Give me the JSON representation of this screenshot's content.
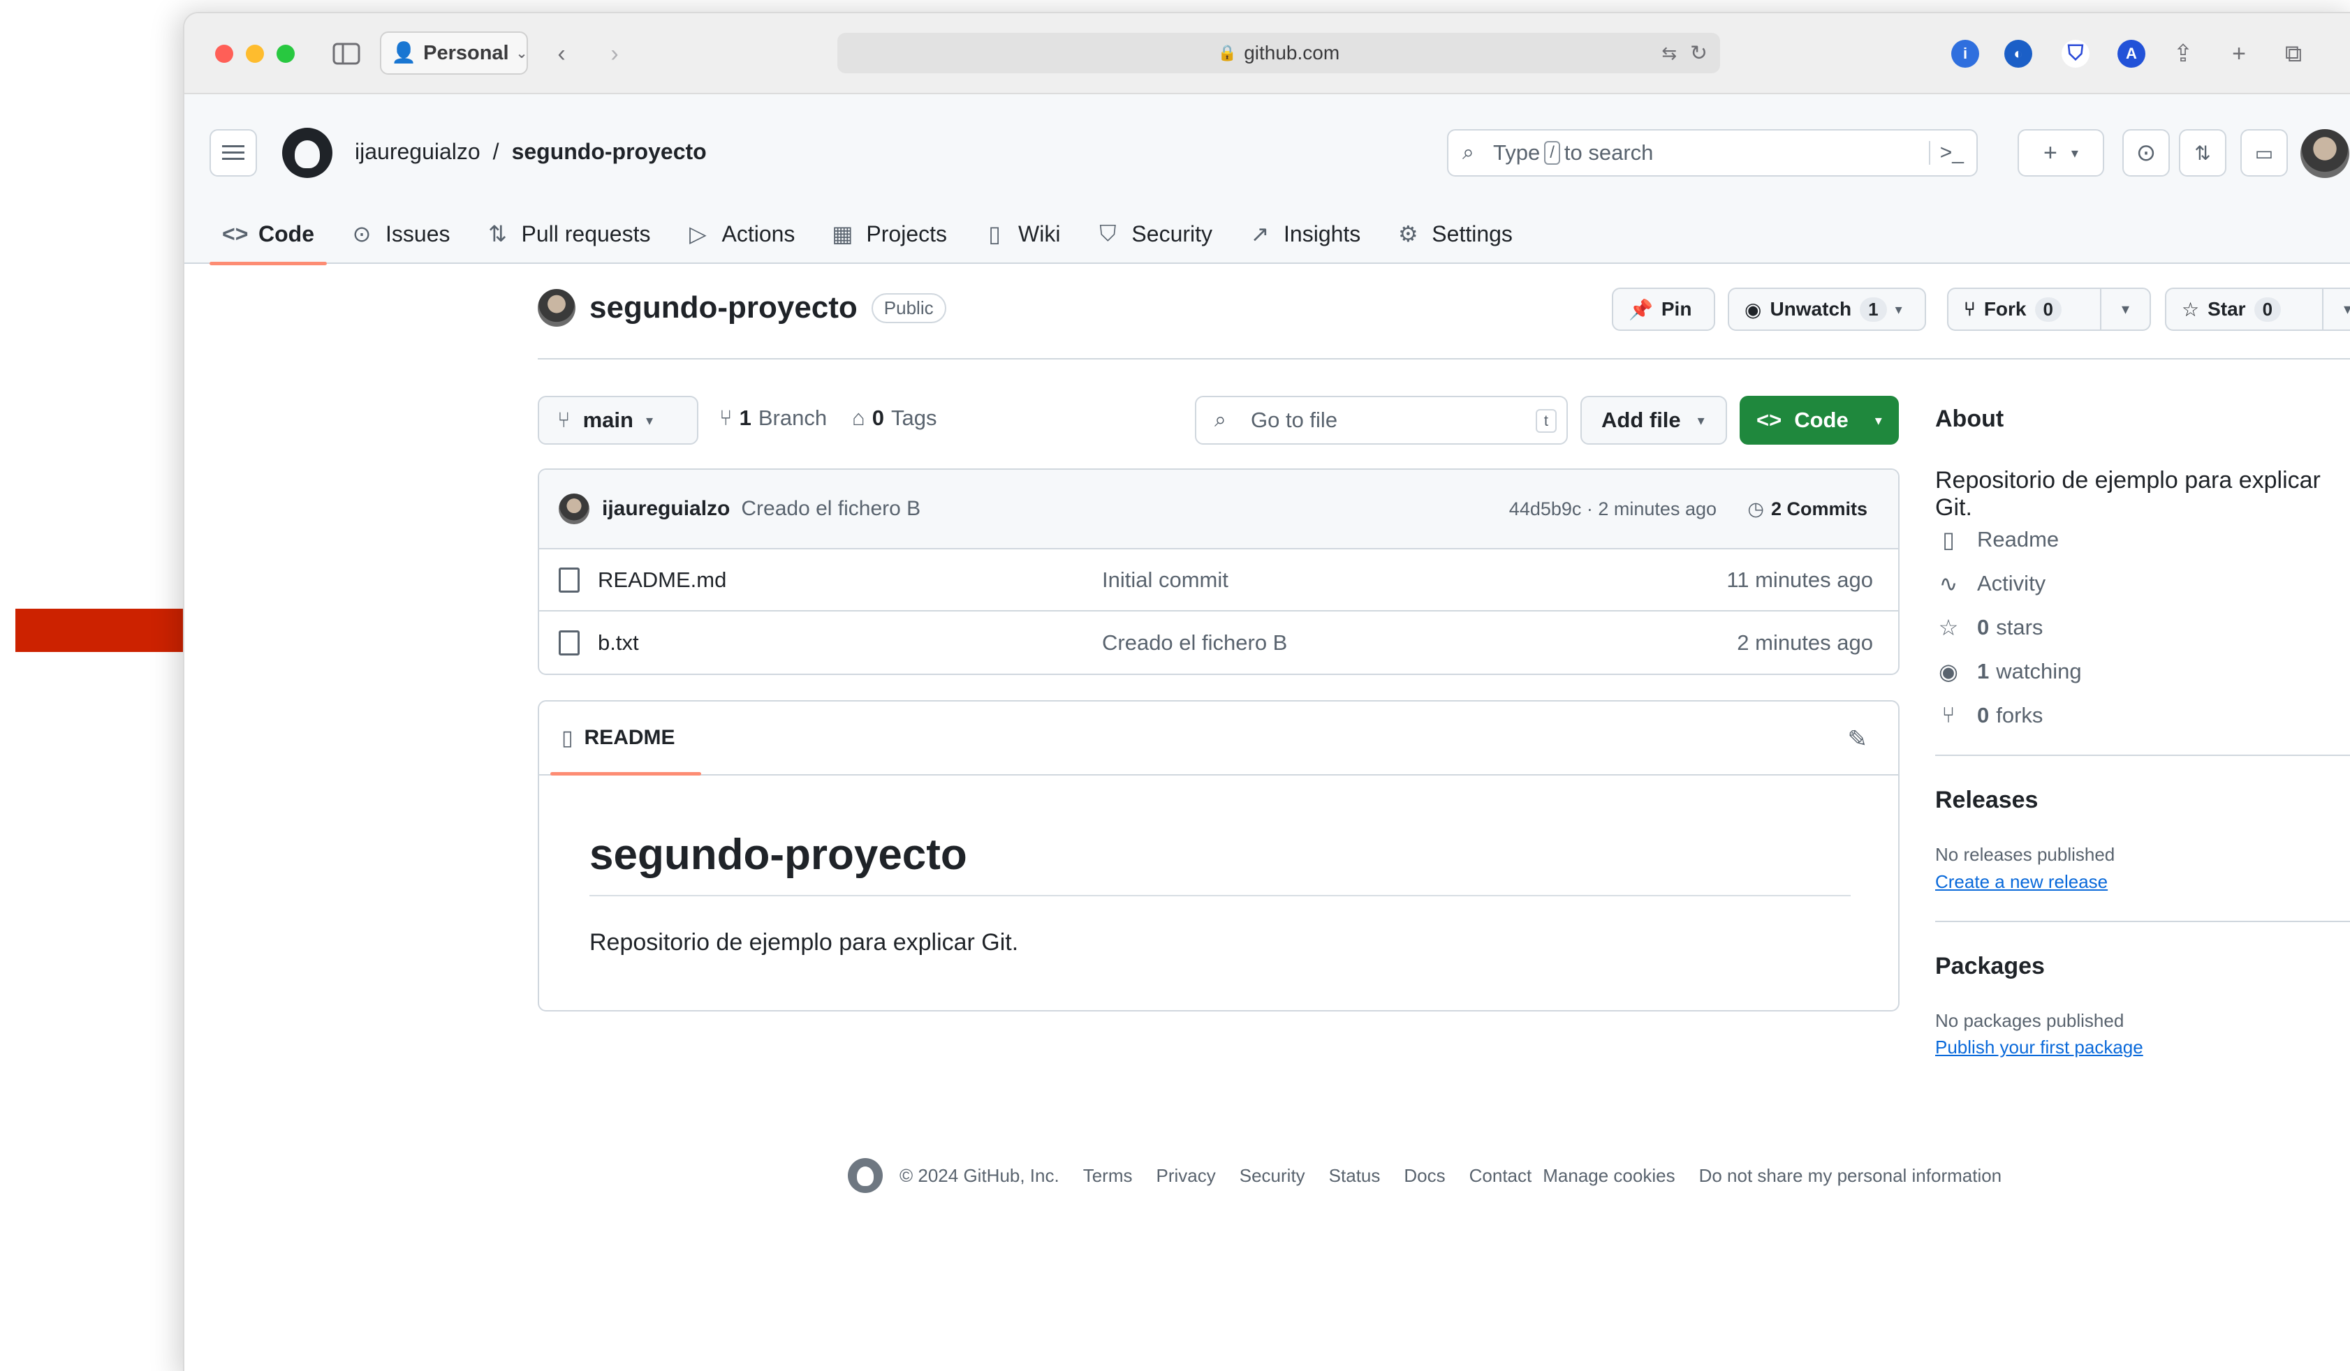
{
  "browser": {
    "profile": "Personal",
    "url": "github.com"
  },
  "header": {
    "owner": "ijaureguialzo",
    "separator": "/",
    "repo": "segundo-proyecto",
    "search_prefix": "Type",
    "search_key": "/",
    "search_suffix": "to search"
  },
  "tabs": [
    {
      "label": "Code",
      "icon": "code-icon"
    },
    {
      "label": "Issues",
      "icon": "issue-icon"
    },
    {
      "label": "Pull requests",
      "icon": "pull-request-icon"
    },
    {
      "label": "Actions",
      "icon": "play-icon"
    },
    {
      "label": "Projects",
      "icon": "table-icon"
    },
    {
      "label": "Wiki",
      "icon": "book-icon"
    },
    {
      "label": "Security",
      "icon": "shield-icon"
    },
    {
      "label": "Insights",
      "icon": "graph-icon"
    },
    {
      "label": "Settings",
      "icon": "gear-icon"
    }
  ],
  "repo": {
    "name": "segundo-proyecto",
    "visibility": "Public",
    "pin": "Pin",
    "unwatch": "Unwatch",
    "watch_count": "1",
    "fork": "Fork",
    "fork_count": "0",
    "star": "Star",
    "star_count": "0"
  },
  "branchbar": {
    "branch": "main",
    "branches_count": "1",
    "branches_label": "Branch",
    "tags_count": "0",
    "tags_label": "Tags",
    "goto_placeholder": "Go to file",
    "goto_key": "t",
    "add_file": "Add file",
    "code": "Code"
  },
  "commit": {
    "author": "ijaureguialzo",
    "message": "Creado el fichero B",
    "sha_time": "44d5b9c · 2 minutes ago",
    "commits": "2 Commits"
  },
  "files": [
    {
      "name": "README.md",
      "message": "Initial commit",
      "time": "11 minutes ago"
    },
    {
      "name": "b.txt",
      "message": "Creado el fichero B",
      "time": "2 minutes ago"
    }
  ],
  "readme": {
    "tab": "README",
    "title": "segundo-proyecto",
    "text": "Repositorio de ejemplo para explicar Git."
  },
  "about": {
    "heading": "About",
    "description": "Repositorio de ejemplo para explicar Git.",
    "readme": "Readme",
    "activity": "Activity",
    "stars_count": "0",
    "stars_label": "stars",
    "watching_count": "1",
    "watching_label": "watching",
    "forks_count": "0",
    "forks_label": "forks"
  },
  "releases": {
    "heading": "Releases",
    "none": "No releases published",
    "link": "Create a new release"
  },
  "packages": {
    "heading": "Packages",
    "none": "No packages published",
    "link": "Publish your first package"
  },
  "footer": {
    "copyright": "© 2024 GitHub, Inc.",
    "links": [
      "Terms",
      "Privacy",
      "Security",
      "Status",
      "Docs",
      "Contact",
      "Manage cookies",
      "Do not share my personal information"
    ]
  },
  "colors": {
    "accent_green": "#1f883d",
    "tab_underline": "#fd8c73",
    "link_blue": "#0969da",
    "arrow_red": "#cc2200"
  }
}
